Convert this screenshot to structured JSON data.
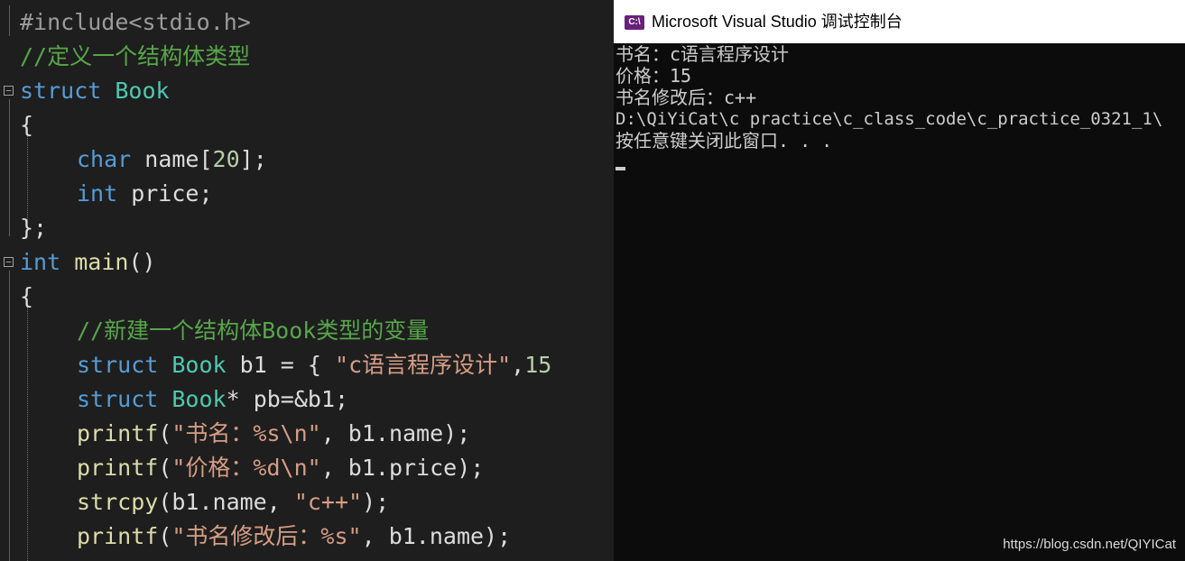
{
  "editor": {
    "lines": [
      [
        {
          "c": "pp",
          "t": "#include<stdio.h>"
        }
      ],
      [
        {
          "c": "cmt",
          "t": "//定义一个结构体类型"
        }
      ],
      [
        {
          "c": "kw",
          "t": "struct"
        },
        {
          "c": "plain",
          "t": " "
        },
        {
          "c": "type",
          "t": "Book"
        }
      ],
      [
        {
          "c": "plain",
          "t": "{"
        }
      ],
      [
        {
          "c": "kw",
          "t": "char"
        },
        {
          "c": "plain",
          "t": " name["
        },
        {
          "c": "num",
          "t": "20"
        },
        {
          "c": "plain",
          "t": "];"
        }
      ],
      [
        {
          "c": "kw",
          "t": "int"
        },
        {
          "c": "plain",
          "t": " price;"
        }
      ],
      [
        {
          "c": "plain",
          "t": "};"
        }
      ],
      [
        {
          "c": "kw",
          "t": "int"
        },
        {
          "c": "plain",
          "t": " "
        },
        {
          "c": "fn",
          "t": "main"
        },
        {
          "c": "plain",
          "t": "()"
        }
      ],
      [
        {
          "c": "plain",
          "t": "{"
        }
      ],
      [
        {
          "c": "cmt",
          "t": "//新建一个结构体Book类型的变量"
        }
      ],
      [
        {
          "c": "kw",
          "t": "struct"
        },
        {
          "c": "plain",
          "t": " "
        },
        {
          "c": "type",
          "t": "Book"
        },
        {
          "c": "plain",
          "t": " b1 = { "
        },
        {
          "c": "str",
          "t": "\"c语言程序设计\""
        },
        {
          "c": "plain",
          "t": ","
        },
        {
          "c": "num",
          "t": "15"
        }
      ],
      [
        {
          "c": "kw",
          "t": "struct"
        },
        {
          "c": "plain",
          "t": " "
        },
        {
          "c": "type",
          "t": "Book"
        },
        {
          "c": "plain",
          "t": "* pb=&b1;"
        }
      ],
      [
        {
          "c": "fn",
          "t": "printf"
        },
        {
          "c": "plain",
          "t": "("
        },
        {
          "c": "str",
          "t": "\"书名：%s\\n\""
        },
        {
          "c": "plain",
          "t": ", b1.name);"
        }
      ],
      [
        {
          "c": "fn",
          "t": "printf"
        },
        {
          "c": "plain",
          "t": "("
        },
        {
          "c": "str",
          "t": "\"价格：%d\\n\""
        },
        {
          "c": "plain",
          "t": ", b1.price);"
        }
      ],
      [
        {
          "c": "fn",
          "t": "strcpy"
        },
        {
          "c": "plain",
          "t": "(b1.name, "
        },
        {
          "c": "str",
          "t": "\"c++\""
        },
        {
          "c": "plain",
          "t": ");"
        }
      ],
      [
        {
          "c": "fn",
          "t": "printf"
        },
        {
          "c": "plain",
          "t": "("
        },
        {
          "c": "str",
          "t": "\"书名修改后：%s\""
        },
        {
          "c": "plain",
          "t": ", b1.name);"
        }
      ]
    ]
  },
  "console": {
    "title": "Microsoft Visual Studio 调试控制台",
    "icon_label": "C:\\",
    "output": [
      "书名：c语言程序设计",
      "价格：15",
      "书名修改后：c++",
      "D:\\QiYiCat\\c practice\\c_class_code\\c_practice_0321_1\\",
      "按任意键关闭此窗口. . ."
    ]
  },
  "watermark": "https://blog.csdn.net/QIYICat",
  "colors": {
    "editor_bg": "#1e1e1e",
    "console_bg": "#0c0c0c",
    "keyword": "#569cd6",
    "type": "#4ec9b0",
    "string": "#d69d85",
    "comment": "#57a64a",
    "vs_purple": "#68217a"
  }
}
